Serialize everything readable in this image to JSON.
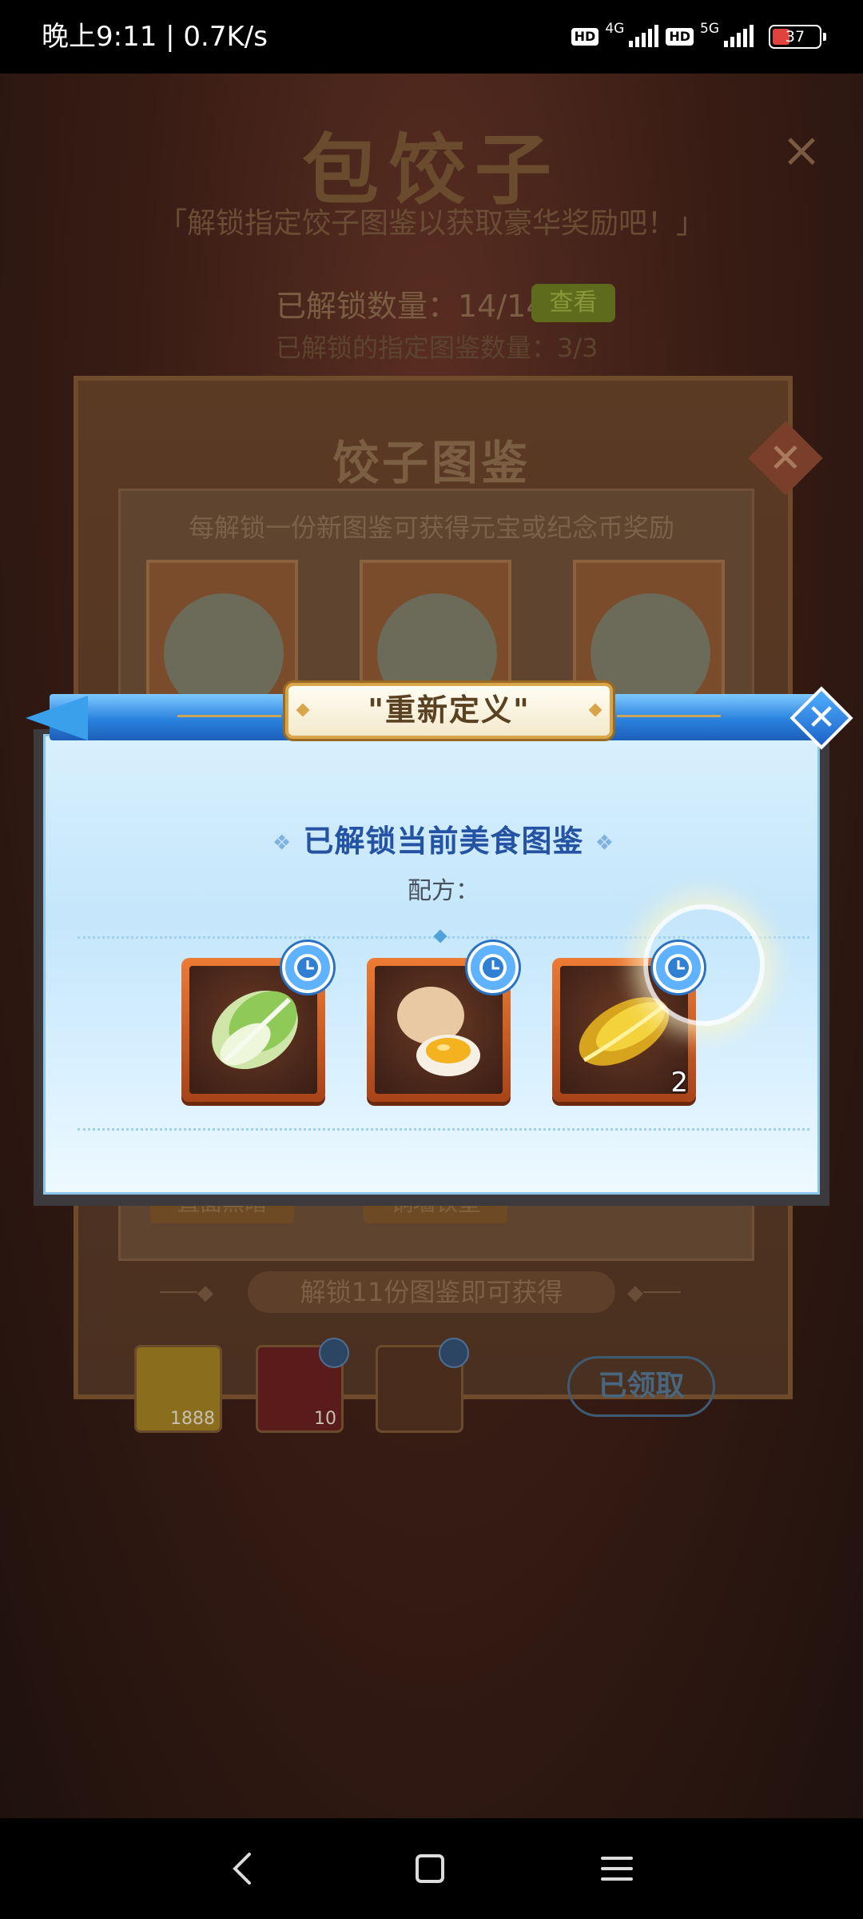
{
  "status_bar": {
    "time_speed": "晚上9:11 | 0.7K/s",
    "hd1": "HD",
    "net1": "4G",
    "hd2": "HD",
    "net2": "5G",
    "battery": "37",
    "battery_level": 0.37
  },
  "background": {
    "title": "包饺子",
    "subtitle": "「解锁指定饺子图鉴以获取豪华奖励吧！」",
    "unlocked_count": "已解锁数量：14/14",
    "check_badge": "查看",
    "unlocked_count2": "已解锁的指定图鉴数量：3/3",
    "codex": {
      "title": "饺子图鉴",
      "description": "每解锁一份新图鉴可获得元宝或纪念币奖励",
      "card_labels": [
        "\"直面黑暗\"",
        "\"铜墙铁壁\""
      ],
      "unlock_banner": "解锁11份图鉴即可获得",
      "rewards": [
        {
          "name": "gold-ingot",
          "count": "1888"
        },
        {
          "name": "sword-token",
          "count": "10"
        },
        {
          "name": "helmet-token",
          "count": ""
        }
      ],
      "claimed_label": "已领取"
    }
  },
  "dialog": {
    "title": "\"重新定义\"",
    "heading": "已解锁当前美食图鉴",
    "heading_deco": "❖",
    "recipe_label": "配方：",
    "close_label": "✕",
    "ingredients": [
      {
        "name": "cabbage",
        "qty": ""
      },
      {
        "name": "egg",
        "qty": ""
      },
      {
        "name": "yellow-chive",
        "qty": "2"
      }
    ]
  },
  "colors": {
    "dialog_header": "#2a82de",
    "dialog_panel": "#c5e6fb",
    "heading": "#2453a3",
    "ingredient_frame": "#ed7b34"
  }
}
